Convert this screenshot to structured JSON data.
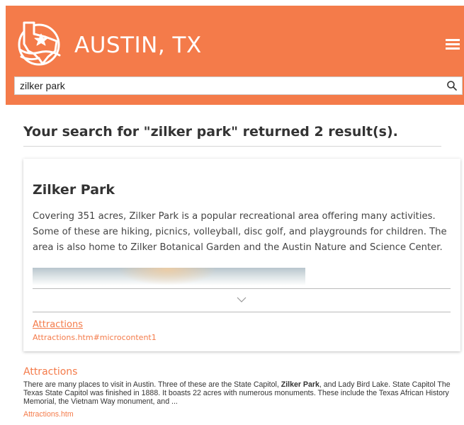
{
  "header": {
    "site_title": "AUSTIN, TX",
    "logo_icon": "texas-star-logo-icon",
    "menu_icon": "hamburger-menu-icon",
    "brand_color": "#f47b4a"
  },
  "search": {
    "value": "zilker park",
    "placeholder": "",
    "button_icon": "search-icon"
  },
  "results": {
    "heading": "Your search for \"zilker park\" returned 2 result(s).",
    "items": [
      {
        "title": "Zilker Park",
        "description": "Covering 351 acres, Zilker Park is a popular recreational area offering many activities. Some of these are hiking, picnics, volleyball, disc golf, and playgrounds for children. The area is also home to Zilker Botanical Garden and the Austin Nature and Science Center.",
        "expand_icon": "chevron-down-icon",
        "link_label": "Attractions",
        "link_url": "Attractions.htm#microcontent1"
      },
      {
        "title": "Attractions",
        "snippet_before": "There are many places to visit in Austin. Three of these are the State Capitol, ",
        "snippet_bold": "Zilker Park",
        "snippet_after": ", and Lady Bird Lake. State Capitol The Texas State Capitol was finished in 1888. It boasts 22 acres with numerous monuments. These include the Texas African History Memorial, the Vietnam Way monument, and ...",
        "url": "Attractions.htm"
      }
    ]
  }
}
